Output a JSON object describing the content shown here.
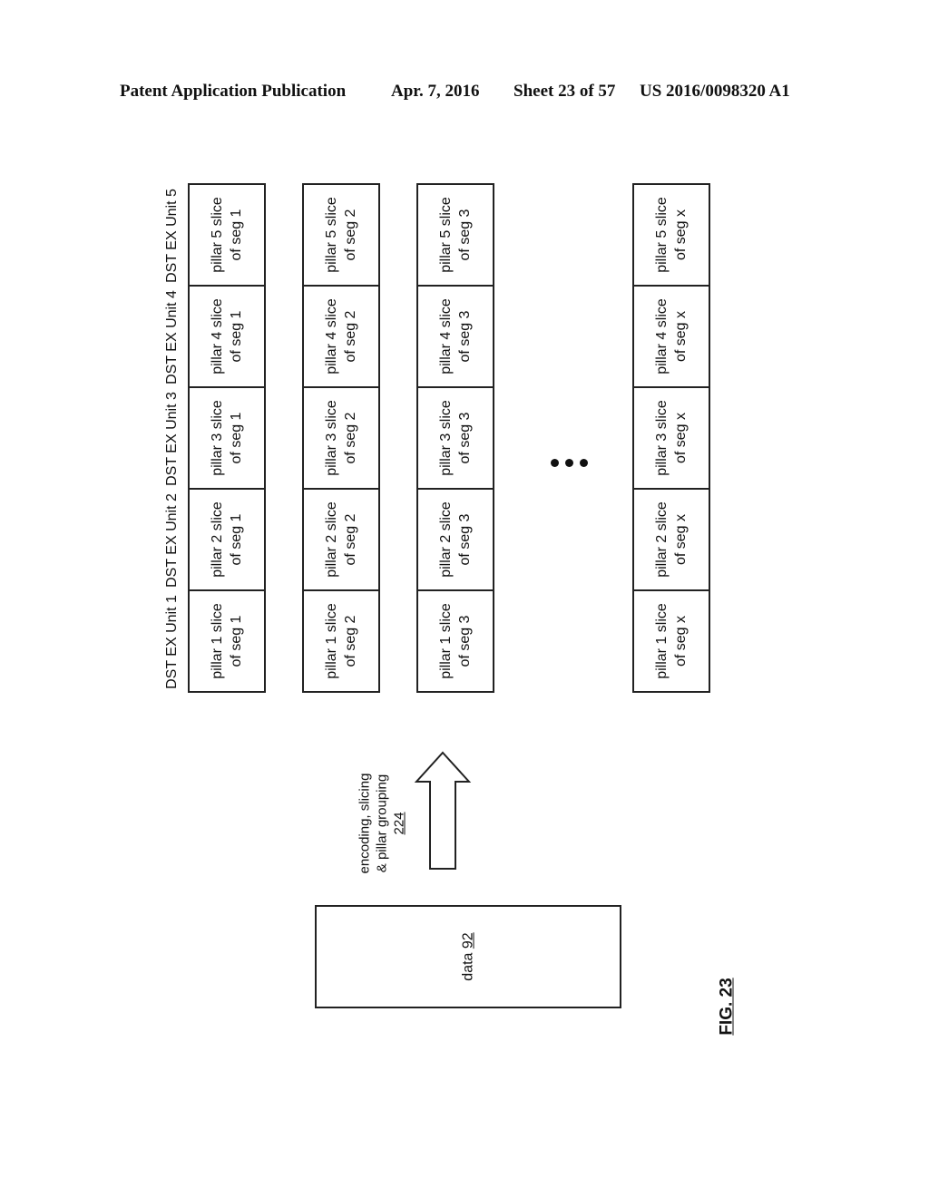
{
  "header": {
    "left": "Patent Application Publication",
    "date": "Apr. 7, 2016",
    "sheet": "Sheet 23 of 57",
    "pub_number": "US 2016/0098320 A1"
  },
  "unit_labels": [
    "DST EX Unit 1",
    "DST EX Unit 2",
    "DST EX Unit 3",
    "DST EX Unit 4",
    "DST EX Unit 5"
  ],
  "segments": [
    {
      "name": "seg 1",
      "cells": [
        [
          "pillar 1 slice",
          "of seg 1"
        ],
        [
          "pillar 2 slice",
          "of seg 1"
        ],
        [
          "pillar 3 slice",
          "of seg 1"
        ],
        [
          "pillar 4 slice",
          "of seg 1"
        ],
        [
          "pillar 5 slice",
          "of seg 1"
        ]
      ]
    },
    {
      "name": "seg 2",
      "cells": [
        [
          "pillar 1 slice",
          "of seg 2"
        ],
        [
          "pillar 2 slice",
          "of seg 2"
        ],
        [
          "pillar 3 slice",
          "of seg 2"
        ],
        [
          "pillar 4 slice",
          "of seg 2"
        ],
        [
          "pillar 5 slice",
          "of seg 2"
        ]
      ]
    },
    {
      "name": "seg 3",
      "cells": [
        [
          "pillar 1 slice",
          "of seg 3"
        ],
        [
          "pillar 2 slice",
          "of seg 3"
        ],
        [
          "pillar 3 slice",
          "of seg 3"
        ],
        [
          "pillar 4 slice",
          "of seg 3"
        ],
        [
          "pillar 5 slice",
          "of seg 3"
        ]
      ]
    },
    {
      "name": "seg x",
      "cells": [
        [
          "pillar 1 slice",
          "of seg x"
        ],
        [
          "pillar 2 slice",
          "of seg x"
        ],
        [
          "pillar 3 slice",
          "of seg x"
        ],
        [
          "pillar 4 slice",
          "of seg x"
        ],
        [
          "pillar 5 slice",
          "of seg x"
        ]
      ]
    }
  ],
  "ellipsis": "•••",
  "arrow": {
    "line1": "encoding, slicing",
    "line2": "& pillar grouping",
    "ref": "224"
  },
  "data_box": {
    "label": "data",
    "ref": "92"
  },
  "figure_label": "FIG. 23"
}
